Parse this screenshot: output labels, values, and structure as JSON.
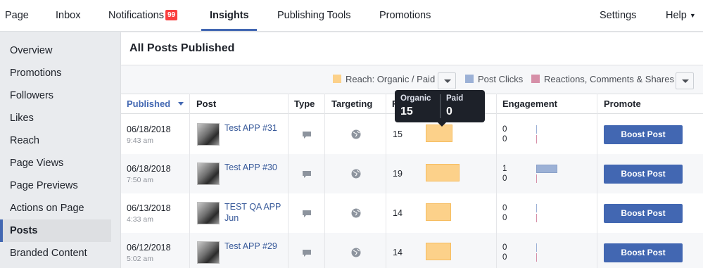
{
  "topnav": {
    "page": "Page",
    "inbox": "Inbox",
    "notifications": "Notifications",
    "notifications_count": "99",
    "insights": "Insights",
    "publishing_tools": "Publishing Tools",
    "promotions": "Promotions",
    "settings": "Settings",
    "help": "Help",
    "active_tab": "Insights"
  },
  "sidebar": {
    "items": [
      {
        "label": "Overview"
      },
      {
        "label": "Promotions"
      },
      {
        "label": "Followers"
      },
      {
        "label": "Likes"
      },
      {
        "label": "Reach"
      },
      {
        "label": "Page Views"
      },
      {
        "label": "Page Previews"
      },
      {
        "label": "Actions on Page"
      },
      {
        "label": "Posts"
      },
      {
        "label": "Branded Content"
      }
    ],
    "active": "Posts"
  },
  "main": {
    "title": "All Posts Published",
    "legend": {
      "reach": "Reach: Organic / Paid",
      "post_clicks": "Post Clicks",
      "reactions": "Reactions, Comments & Shares"
    },
    "columns": {
      "published": "Published",
      "post": "Post",
      "type": "Type",
      "targeting": "Targeting",
      "reach": "R",
      "engagement": "Engagement",
      "promote": "Promote"
    },
    "tooltip": {
      "organic_label": "Organic",
      "organic_value": "15",
      "paid_label": "Paid",
      "paid_value": "0"
    },
    "rows": [
      {
        "date": "06/18/2018",
        "time": "9:43 am",
        "post": "Test APP #31",
        "post_line2": "",
        "reach": "15",
        "reach_fraction": 0.79,
        "eng_clicks": "0",
        "eng_reactions": "0",
        "boost": "Boost Post"
      },
      {
        "date": "06/18/2018",
        "time": "7:50 am",
        "post": "Test APP #30",
        "post_line2": "",
        "reach": "19",
        "reach_fraction": 1.0,
        "eng_clicks": "1",
        "eng_reactions": "0",
        "boost": "Boost Post"
      },
      {
        "date": "06/13/2018",
        "time": "4:33 am",
        "post": "TEST QA APP",
        "post_line2": "Jun",
        "reach": "14",
        "reach_fraction": 0.74,
        "eng_clicks": "0",
        "eng_reactions": "0",
        "boost": "Boost Post"
      },
      {
        "date": "06/12/2018",
        "time": "5:02 am",
        "post": "Test APP #29",
        "post_line2": "",
        "reach": "14",
        "reach_fraction": 0.74,
        "eng_clicks": "0",
        "eng_reactions": "0",
        "boost": "Boost Post"
      }
    ]
  },
  "colors": {
    "accent": "#4267b2",
    "reach_swatch": "#fcd18a",
    "post_clicks_swatch": "#9cb1d6",
    "reactions_swatch": "#d68fa8",
    "badge": "#fa3e3e"
  },
  "icons": {
    "type": "comment-bubble-icon",
    "targeting": "globe-icon",
    "sort": "caret-down-icon",
    "dropdown": "chevron-down-icon"
  }
}
